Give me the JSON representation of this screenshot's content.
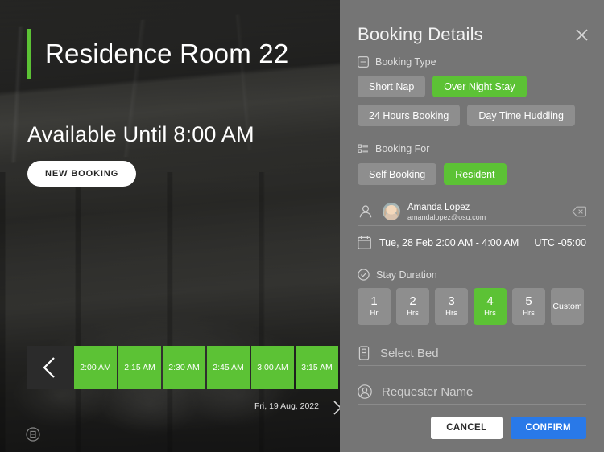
{
  "room": {
    "title": "Residence Room 22",
    "availability": "Available Until 8:00 AM",
    "new_booking_label": "NEW BOOKING",
    "accent_color": "#5CC235",
    "logo_icon": "brand-circle-b-icon",
    "prev_icon": "chevron-left-icon",
    "next_icon": "chevron-right-icon",
    "strip_date": "Fri, 19 Aug, 2022",
    "slots": [
      {
        "time": "2:00 AM",
        "state": "available"
      },
      {
        "time": "2:15 AM",
        "state": "available"
      },
      {
        "time": "2:30 AM",
        "state": "available"
      },
      {
        "time": "2:45 AM",
        "state": "available"
      },
      {
        "time": "3:00 AM",
        "state": "available"
      },
      {
        "time": "3:15 AM",
        "state": "available"
      }
    ],
    "slot_color": "#5CC235"
  },
  "panel": {
    "title": "Booking Details",
    "close_icon": "close-icon",
    "booking_type": {
      "icon": "list-menu-icon",
      "label": "Booking Type",
      "options": [
        {
          "label": "Short Nap",
          "selected": false
        },
        {
          "label": "Over Night Stay",
          "selected": true
        },
        {
          "label": "24 Hours Booking",
          "selected": false
        },
        {
          "label": "Day Time Huddling",
          "selected": false
        }
      ]
    },
    "booking_for": {
      "icon": "checklist-icon",
      "label": "Booking For",
      "options": [
        {
          "label": "Self Booking",
          "selected": false
        },
        {
          "label": "Resident",
          "selected": true
        }
      ]
    },
    "user": {
      "icon": "person-icon",
      "avatar": "user-avatar",
      "name": "Amanda Lopez",
      "email": "amandalopez@osu.com",
      "clear_icon": "backspace-delete-icon"
    },
    "schedule": {
      "icon": "calendar-icon",
      "text": "Tue, 28 Feb 2:00 AM - 4:00 AM",
      "timezone": "UTC -05:00"
    },
    "stay_duration": {
      "icon": "clock-check-icon",
      "label": "Stay Duration",
      "options": [
        {
          "value": "1",
          "unit": "Hr",
          "selected": false
        },
        {
          "value": "2",
          "unit": "Hrs",
          "selected": false
        },
        {
          "value": "3",
          "unit": "Hrs",
          "selected": false
        },
        {
          "value": "4",
          "unit": "Hrs",
          "selected": true
        },
        {
          "value": "5",
          "unit": "Hrs",
          "selected": false
        }
      ],
      "custom_label": "Custom"
    },
    "fields": [
      {
        "icon": "bed-icon",
        "placeholder": "Select Bed",
        "value": ""
      },
      {
        "icon": "person-circle-icon",
        "placeholder": "Requester Name",
        "value": ""
      }
    ],
    "actions": {
      "cancel_label": "CANCEL",
      "confirm_label": "CONFIRM",
      "confirm_color": "#2979E8"
    },
    "background_color": "#757575",
    "chip_color": "#8E8E8E",
    "selected_color": "#5CC235"
  }
}
